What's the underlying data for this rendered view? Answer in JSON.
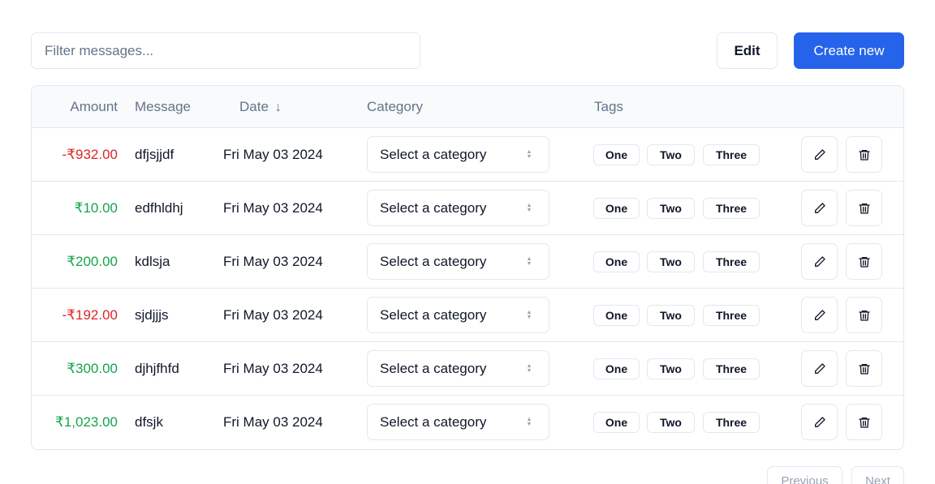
{
  "toolbar": {
    "filter_placeholder": "Filter messages...",
    "edit_label": "Edit",
    "create_label": "Create new"
  },
  "table": {
    "headers": {
      "amount": "Amount",
      "message": "Message",
      "date": "Date",
      "category": "Category",
      "tags": "Tags"
    },
    "sort_icon": "arrow-down-icon",
    "rows": [
      {
        "amount": "-₹932.00",
        "sign": "negative",
        "message": "dfjsjjdf",
        "date": "Fri May 03 2024",
        "category": "Select a category",
        "tags": [
          "One",
          "Two",
          "Three"
        ]
      },
      {
        "amount": "₹10.00",
        "sign": "positive",
        "message": "edfhldhj",
        "date": "Fri May 03 2024",
        "category": "Select a category",
        "tags": [
          "One",
          "Two",
          "Three"
        ]
      },
      {
        "amount": "₹200.00",
        "sign": "positive",
        "message": "kdlsja",
        "date": "Fri May 03 2024",
        "category": "Select a category",
        "tags": [
          "One",
          "Two",
          "Three"
        ]
      },
      {
        "amount": "-₹192.00",
        "sign": "negative",
        "message": "sjdjjjs",
        "date": "Fri May 03 2024",
        "category": "Select a category",
        "tags": [
          "One",
          "Two",
          "Three"
        ]
      },
      {
        "amount": "₹300.00",
        "sign": "positive",
        "message": "djhjfhfd",
        "date": "Fri May 03 2024",
        "category": "Select a category",
        "tags": [
          "One",
          "Two",
          "Three"
        ]
      },
      {
        "amount": "₹1,023.00",
        "sign": "positive",
        "message": "dfsjk",
        "date": "Fri May 03 2024",
        "category": "Select a category",
        "tags": [
          "One",
          "Two",
          "Three"
        ]
      }
    ]
  },
  "pagination": {
    "previous_label": "Previous",
    "next_label": "Next"
  },
  "colors": {
    "accent": "#2563eb",
    "negative": "#dc2626",
    "positive": "#16a34a",
    "border": "#e2e8f0",
    "muted_text": "#64748b"
  }
}
